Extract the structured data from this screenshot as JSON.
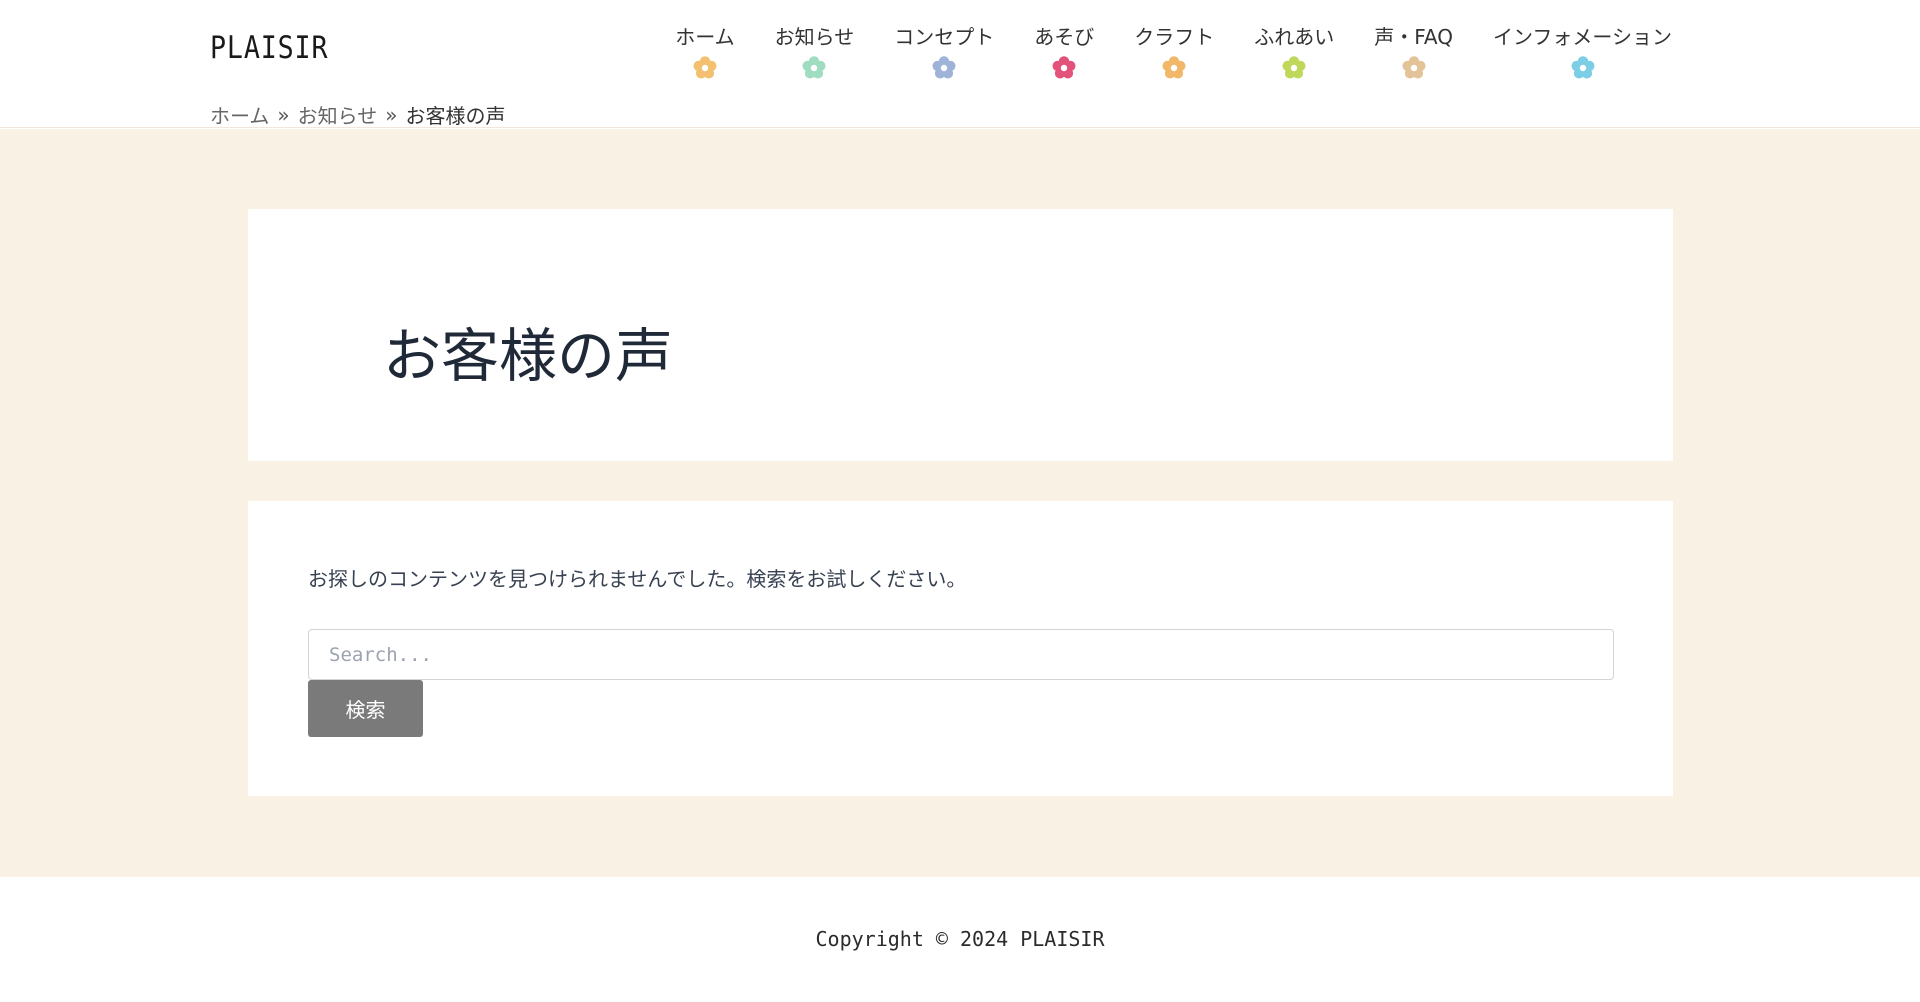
{
  "header": {
    "logo": "PLAISIR",
    "nav": [
      {
        "label": "ホーム",
        "flower_color": "#f3c06f"
      },
      {
        "label": "お知らせ",
        "flower_color": "#9fdcc0"
      },
      {
        "label": "コンセプト",
        "flower_color": "#9fb3d8"
      },
      {
        "label": "あそび",
        "flower_color": "#e2527a"
      },
      {
        "label": "クラフト",
        "flower_color": "#f2b86a"
      },
      {
        "label": "ふれあい",
        "flower_color": "#bfd85a"
      },
      {
        "label": "声・FAQ",
        "flower_color": "#e3c398"
      },
      {
        "label": "インフォメーション",
        "flower_color": "#7ccde6"
      }
    ]
  },
  "breadcrumb": {
    "home": "ホーム",
    "separator": "»",
    "news": "お知らせ",
    "current": "お客様の声"
  },
  "main": {
    "title": "お客様の声",
    "not_found_message": "お探しのコンテンツを見つけられませんでした。検索をお試しください。",
    "search_placeholder": "Search...",
    "search_button": "検索"
  },
  "footer": {
    "copyright": "Copyright © 2024 PLAISIR"
  },
  "colors": {
    "main_bg": "#f9f1e4",
    "button_bg": "#7a7a7a"
  }
}
